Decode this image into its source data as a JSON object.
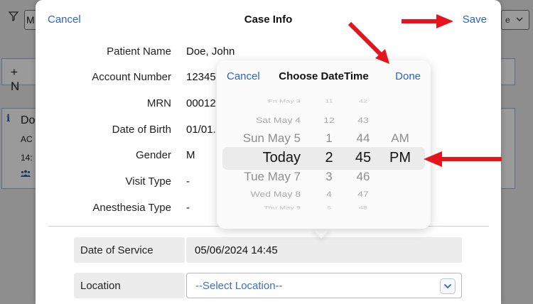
{
  "background": {
    "select_left_text": "M",
    "new_label": "+ N",
    "card_line1": "Do",
    "card_line2": "AC",
    "card_line3": "14:"
  },
  "header": {
    "cancel_label": "Cancel",
    "title": "Case Info",
    "save_label": "Save"
  },
  "fields": [
    {
      "label": "Patient Name",
      "value": "Doe, John"
    },
    {
      "label": "Account Number",
      "value": "12345"
    },
    {
      "label": "MRN",
      "value": "00012"
    },
    {
      "label": "Date of Birth",
      "value": "01/01."
    },
    {
      "label": "Gender",
      "value": "M"
    },
    {
      "label": "Visit Type",
      "value": "-"
    },
    {
      "label": "Anesthesia Type",
      "value": "-"
    }
  ],
  "date_of_service": {
    "label": "Date of Service",
    "value": "05/06/2024 14:45"
  },
  "location": {
    "label": "Location",
    "value": "--Select Location--"
  },
  "picker": {
    "cancel_label": "Cancel",
    "title": "Choose DateTime",
    "done_label": "Done",
    "dates": [
      "Fri May 3",
      "Sat May 4",
      "Sun May 5",
      "Today",
      "Tue May 7",
      "Wed May 8",
      "Thu May 9"
    ],
    "hours": [
      "11",
      "12",
      "1",
      "2",
      "3",
      "4",
      "5"
    ],
    "minutes": [
      "42",
      "43",
      "44",
      "45",
      "46",
      "47",
      "48"
    ],
    "ampm": [
      "AM",
      "PM"
    ],
    "selected_index": 3
  },
  "colors": {
    "link_blue": "#2a64c5",
    "annotation_red": "#e8141b",
    "overlay_gray": "#8e8e8e"
  }
}
